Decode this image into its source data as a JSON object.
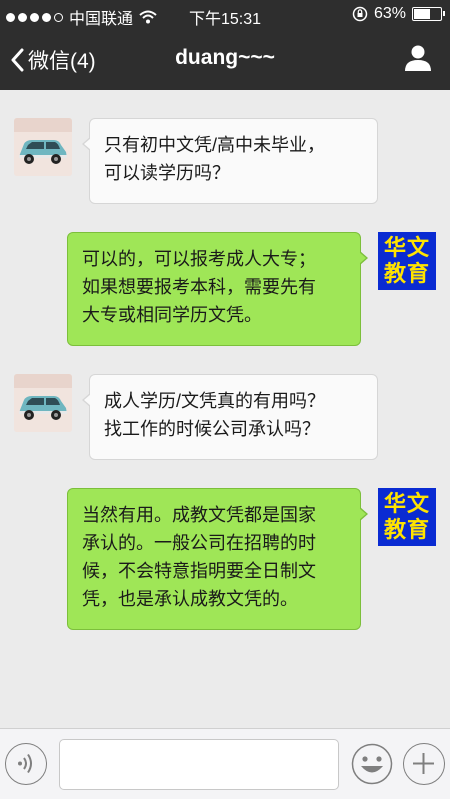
{
  "status_bar": {
    "signal_bars_filled": 4,
    "signal_bars_total": 5,
    "carrier": "中国联通",
    "time": "下午15:31",
    "battery_percent": "63%",
    "battery_level": 0.63,
    "icons": [
      "signal-dots-icon",
      "wifi-icon",
      "rotation-lock-icon",
      "battery-icon"
    ]
  },
  "nav": {
    "back_label": "微信(4)",
    "title": "duang~~~",
    "icons": [
      "chevron-left-icon",
      "person-icon"
    ]
  },
  "messages": [
    {
      "side": "in",
      "avatar": "car-avatar",
      "lines": [
        "只有初中文凭/高中未毕业，",
        "可以读学历吗？"
      ]
    },
    {
      "side": "out",
      "avatar_text": [
        "华文",
        "教育"
      ],
      "lines": [
        "可以的，可以报考成人大专；",
        "如果想要报考本科，需要先有",
        "大专或相同学历文凭。"
      ]
    },
    {
      "side": "in",
      "avatar": "car-avatar",
      "lines": [
        "成人学历/文凭真的有用吗？",
        "找工作的时候公司承认吗？"
      ]
    },
    {
      "side": "out",
      "avatar_text": [
        "华文",
        "教育"
      ],
      "lines": [
        "当然有用。成教文凭都是国家",
        "承认的。一般公司在招聘的时",
        "候，不会特意指明要全日制文",
        "凭，也是承认成教文凭的。"
      ]
    }
  ],
  "input_bar": {
    "placeholder": "",
    "value": "",
    "icons": [
      "voice-icon",
      "emoji-icon",
      "plus-icon"
    ]
  },
  "colors": {
    "header_bg": "#2e2e2e",
    "chat_bg": "#ebebeb",
    "outgoing_bubble": "#9fe657",
    "incoming_bubble": "#fafafa",
    "brand_avatar_bg": "#0a2bd2",
    "brand_avatar_text": "#ffe300"
  }
}
